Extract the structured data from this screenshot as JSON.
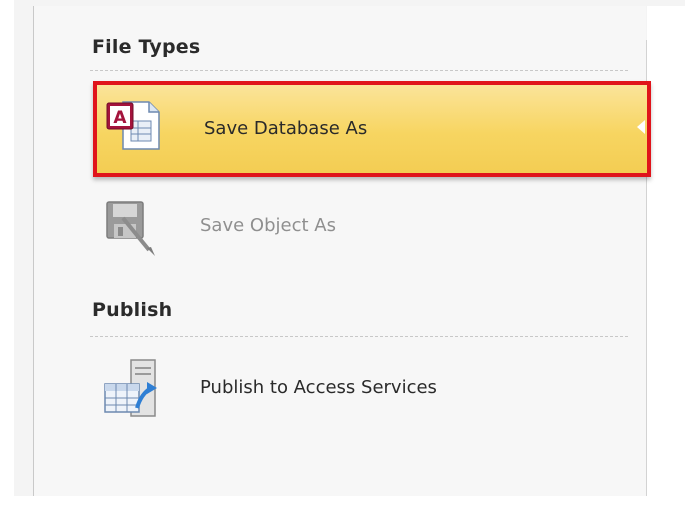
{
  "sections": {
    "file_types": {
      "title": "File Types",
      "items": [
        {
          "label": "Save Database As",
          "icon": "access-database-icon",
          "state": "selected"
        },
        {
          "label": "Save Object As",
          "icon": "save-object-icon",
          "state": "disabled"
        }
      ]
    },
    "publish": {
      "title": "Publish",
      "items": [
        {
          "label": "Publish to Access Services",
          "icon": "publish-services-icon",
          "state": "normal"
        }
      ]
    }
  },
  "colors": {
    "selection_fill": "#f7d561",
    "highlight_outline": "#e0141b",
    "access_brand": "#a4133c"
  }
}
